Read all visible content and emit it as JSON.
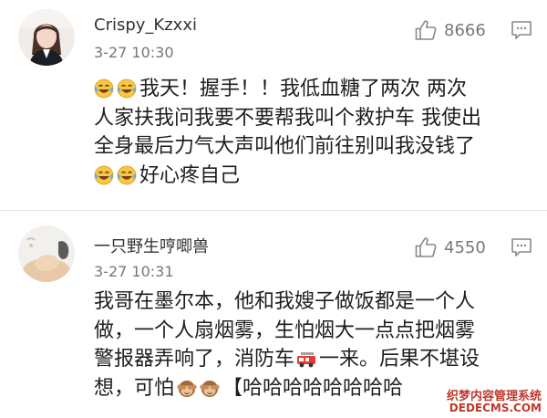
{
  "comments": [
    {
      "username": "Crispy_Kzxxi",
      "time": "3-27 10:30",
      "likes": "8666",
      "lines": [
        "我天！握手！！我低血糖了两次 两次",
        "人家扶我问我要不要帮我叫个救护车 我使出",
        "全身最后力气大声叫他们前往别叫我没钱了",
        "好心疼自己"
      ],
      "emojis": {
        "line1": [
          "laugh-cry-emoji",
          "laugh-cry-emoji"
        ],
        "line4": [
          "laugh-cry-emoji",
          "laugh-cry-emoji"
        ]
      }
    },
    {
      "username": "一只野生哼唧兽",
      "time": "3-27 10:31",
      "likes": "4550",
      "lines": [
        "我哥在墨尔本，他和我嫂子做饭都是一个人",
        "做，一个人扇烟雾，生怕烟大一点点把烟雾",
        "警报器弄响了，消防车",
        "一来。后果不堪设",
        "想，可怕",
        "【哈哈哈哈哈哈哈哈"
      ],
      "emojis": {
        "line3": [
          "fire-engine-emoji"
        ],
        "line4": [
          "see-no-evil-monkey-emoji",
          "see-no-evil-monkey-emoji"
        ]
      }
    }
  ],
  "watermark": {
    "line1": "织梦内容管理系统",
    "line2": "DEDECMS.COM"
  },
  "colors": {
    "text": "#1e1e1e",
    "meta": "#777777",
    "divider": "#e3e3e3",
    "watermark": "#c0392b"
  }
}
